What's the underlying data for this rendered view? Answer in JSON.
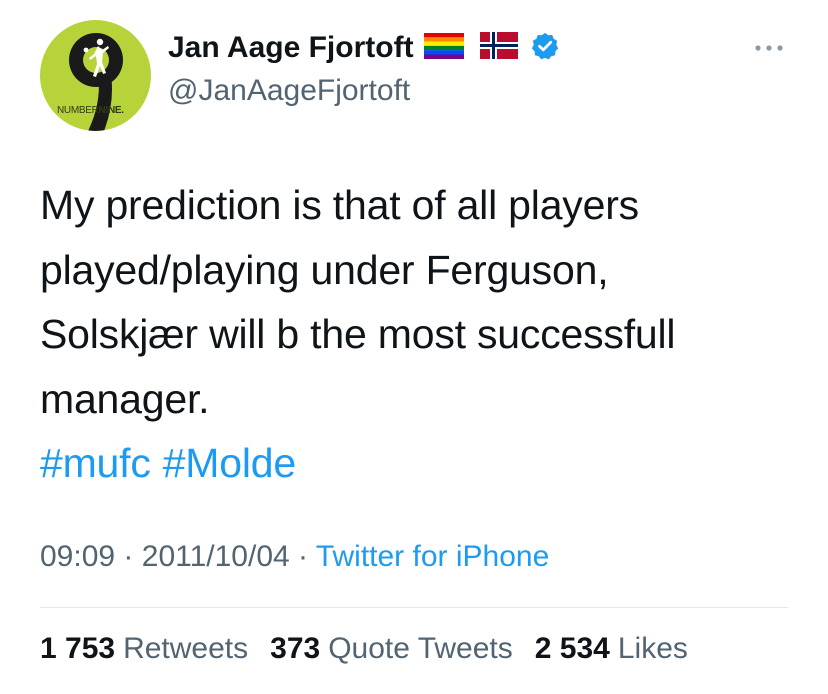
{
  "user": {
    "display_name": "Jan Aage Fjortoft",
    "handle": "@JanAageFjortoft",
    "avatar_text_light": "NUMBER",
    "avatar_text_bold": "NINE.",
    "avatar_number": "9",
    "flags": [
      "rainbow-flag",
      "norway-flag"
    ],
    "verified": true,
    "verified_color": "#1d9bf0"
  },
  "tweet": {
    "lines": [
      "My prediction is that of all players",
      "played/playing under Ferguson,",
      "Solskjær will b the most successfull",
      "manager."
    ],
    "hashtags": [
      "#mufc",
      "#Molde"
    ]
  },
  "meta": {
    "time": "09:09",
    "separator": "·",
    "date": "2011/10/04",
    "source": "Twitter for iPhone"
  },
  "stats": {
    "retweets_count": "1 753",
    "retweets_label": "Retweets",
    "quotes_count": "373",
    "quotes_label": "Quote Tweets",
    "likes_count": "2 534",
    "likes_label": "Likes"
  },
  "colors": {
    "link": "#1d9bf0",
    "secondary_text": "#536471",
    "primary_text": "#0f1419",
    "avatar_bg": "#b6d33a"
  }
}
